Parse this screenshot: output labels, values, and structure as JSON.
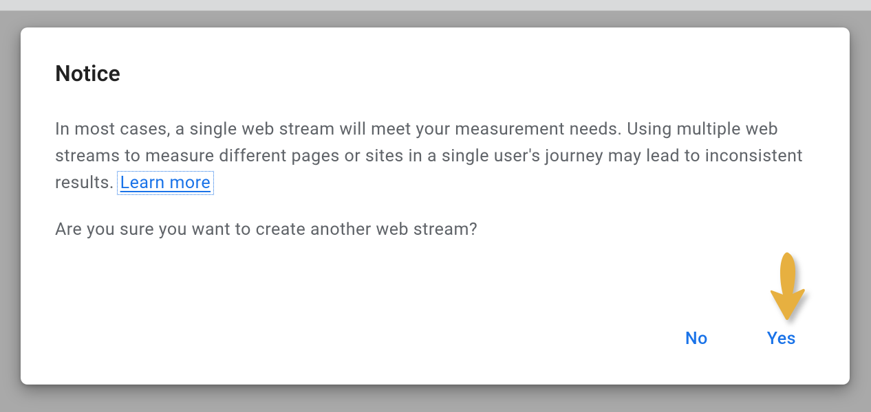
{
  "dialog": {
    "title": "Notice",
    "body_paragraph_pre": "In most cases, a single web stream will meet your measurement needs. Using multiple web streams to measure different pages or sites in a single user's journey may lead to inconsistent results. ",
    "learn_more": "Learn more",
    "confirm_question": "Are you sure you want to create another web stream?",
    "actions": {
      "no": "No",
      "yes": "Yes"
    }
  }
}
